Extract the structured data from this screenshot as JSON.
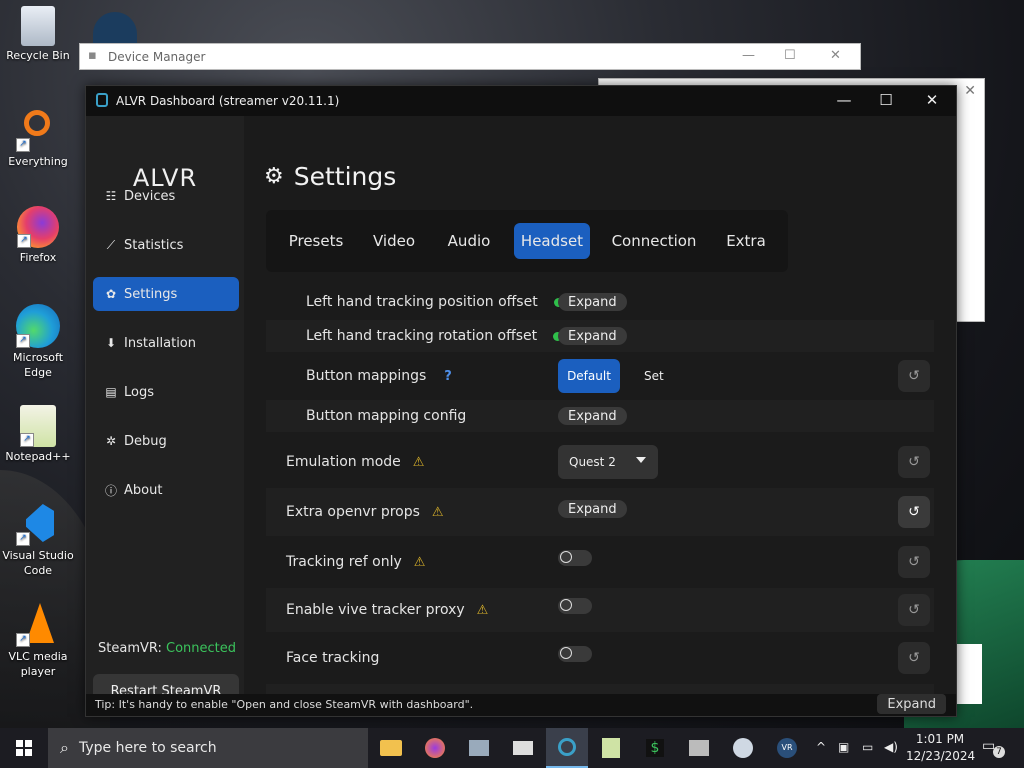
{
  "desktop": {
    "icons": [
      {
        "label": "Recycle Bin"
      },
      {
        "label": "Everything"
      },
      {
        "label": "Firefox"
      },
      {
        "label": "Microsoft Edge"
      },
      {
        "label": "Notepad++"
      },
      {
        "label": "Visual Studio Code"
      },
      {
        "label": "VLC media player"
      }
    ],
    "bg_window_title": "Device Manager"
  },
  "window": {
    "title": "ALVR Dashboard (streamer v20.11.1)",
    "minimize": "—",
    "maximize": "☐",
    "close": "✕"
  },
  "sidebar": {
    "brand": "ALVR",
    "items": [
      {
        "label": "Devices",
        "icon": "devices-icon",
        "glyph": "☷"
      },
      {
        "label": "Statistics",
        "icon": "chart-icon",
        "glyph": "⟋"
      },
      {
        "label": "Settings",
        "icon": "gear-icon",
        "glyph": "✿"
      },
      {
        "label": "Installation",
        "icon": "download-icon",
        "glyph": "⬇"
      },
      {
        "label": "Logs",
        "icon": "logs-icon",
        "glyph": "▤"
      },
      {
        "label": "Debug",
        "icon": "bug-icon",
        "glyph": "✲"
      },
      {
        "label": "About",
        "icon": "info-icon",
        "glyph": "ⓘ"
      }
    ],
    "active": "Settings",
    "steamvr_label": "SteamVR:",
    "steamvr_status": "Connected",
    "restart_label": "Restart SteamVR"
  },
  "main": {
    "title": "Settings",
    "tabs": [
      {
        "label": "Presets"
      },
      {
        "label": "Video"
      },
      {
        "label": "Audio"
      },
      {
        "label": "Headset"
      },
      {
        "label": "Connection"
      },
      {
        "label": "Extra"
      }
    ],
    "active_tab": "Headset",
    "rows": {
      "left_pos_offset": {
        "label": "Left hand tracking position offset",
        "action": "Expand"
      },
      "left_rot_offset": {
        "label": "Left hand tracking rotation offset",
        "action": "Expand"
      },
      "button_mappings": {
        "label": "Button mappings",
        "help": "?",
        "option_default": "Default",
        "option_set": "Set"
      },
      "button_mapping_config": {
        "label": "Button mapping config",
        "action": "Expand"
      },
      "emulation_mode": {
        "label": "Emulation mode",
        "value": "Quest 2"
      },
      "extra_openvr_props": {
        "label": "Extra openvr props",
        "action": "Expand"
      },
      "tracking_ref_only": {
        "label": "Tracking ref only"
      },
      "enable_vive_tracker_proxy": {
        "label": "Enable vive tracker proxy"
      },
      "face_tracking": {
        "label": "Face tracking"
      }
    },
    "warning_glyph": "⚠",
    "reset_glyph": "↺"
  },
  "tipbar": {
    "text": "Tip: It's handy to enable \"Open and close SteamVR with dashboard\".",
    "expand": "Expand"
  },
  "taskbar": {
    "search_placeholder": "Type here to search",
    "time": "1:01 PM",
    "date": "12/23/2024",
    "notification_count": "7"
  }
}
